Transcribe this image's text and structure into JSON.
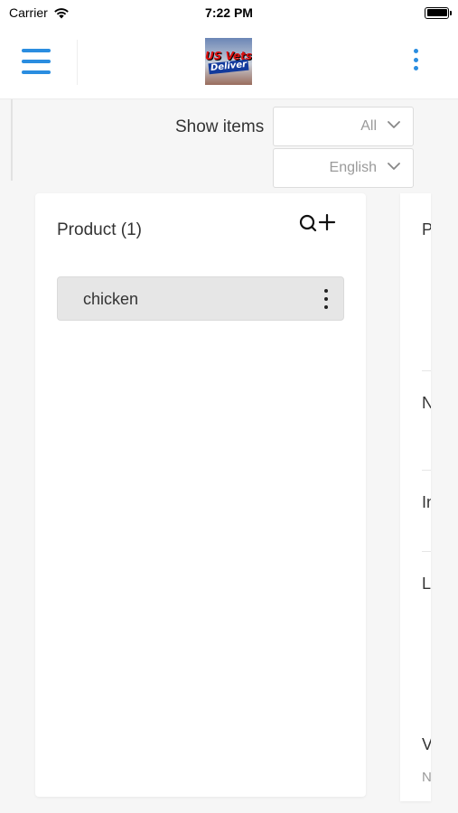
{
  "status_bar": {
    "carrier": "Carrier",
    "time": "7:22 PM"
  },
  "header": {
    "logo_text_line1": "US Vets",
    "logo_text_line2": "Deliver",
    "accent_color": "#2a8de0"
  },
  "filters": {
    "show_items_label": "Show items",
    "items_filter_value": "All",
    "language_value": "English"
  },
  "product_panel": {
    "title": "Product (1)",
    "items": [
      {
        "label": "chicken"
      }
    ]
  },
  "second_panel": {
    "peek_letters": [
      "P",
      "N",
      "In",
      "L",
      "V",
      "N"
    ]
  }
}
